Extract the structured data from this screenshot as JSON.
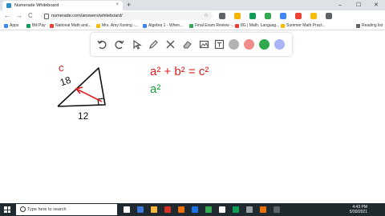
{
  "browser": {
    "tab_title": "Numerade Whiteboard",
    "tab_close": "×",
    "new_tab": "+",
    "window_controls": [
      "–",
      "☐",
      "✕"
    ],
    "url": "numerade.com/answers/whiteboard/",
    "star": "☆",
    "nav": [
      "←",
      "→",
      "C"
    ],
    "extension_colors": [
      "#5f6368",
      "#f4b400",
      "#0f9d58",
      "#34a853",
      "#4285f4",
      "#ea4335",
      "#fbbc05",
      "#5f6368"
    ]
  },
  "bookmarks": [
    {
      "label": "Apps",
      "color": "#4285f4"
    },
    {
      "label": "Bill Pay",
      "color": "#0f9d58"
    },
    {
      "label": "National Math and...",
      "color": "#ea4335"
    },
    {
      "label": "Mrs. Amy Koning -...",
      "color": "#fbbc05"
    },
    {
      "label": "Algebra 1 - When...",
      "color": "#4285f4"
    },
    {
      "label": "Final Exam Review -...",
      "color": "#34a853"
    },
    {
      "label": "8G | Math, Languag...",
      "color": "#ea4335"
    },
    {
      "label": "Summer Math Pract...",
      "color": "#fbbc05"
    },
    {
      "label": "Reading list",
      "color": "#5f6368"
    }
  ],
  "whiteboard": {
    "tool_icons": [
      "undo-icon",
      "redo-icon",
      "select-icon",
      "pen-icon",
      "tools-icon",
      "eraser-icon",
      "image-icon",
      "text-icon"
    ],
    "colors": [
      "#b3b3b3",
      "#f28b8b",
      "#2fa84f",
      "#009900",
      "#a9b4f5"
    ],
    "annotations": {
      "hypotenuse_letter": "c",
      "hypotenuse_value": "18",
      "base_value": "12",
      "equation": "a² + b² = c²",
      "next_line": "a²"
    }
  },
  "taskbar": {
    "search_placeholder": "Type here to search",
    "time": "4:43 PM",
    "date": "5/30/2021",
    "app_colors": [
      "#ffffff",
      "#3c78d8",
      "#f6b73c",
      "#d93025",
      "#e8710a",
      "#1a73e8",
      "#34a853",
      "#ffffff",
      "#0f9d58",
      "#9aa0a6",
      "#e8710a",
      "#5f6368"
    ]
  }
}
